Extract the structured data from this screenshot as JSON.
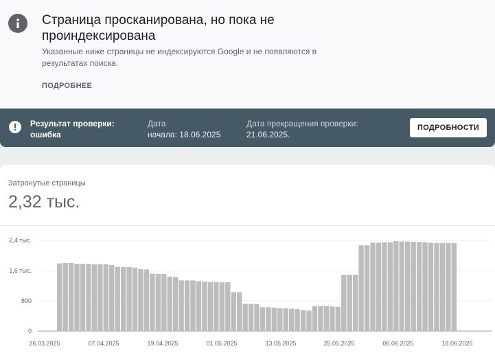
{
  "info": {
    "title": "Страница просканирована, но пока не проиндексирована",
    "description": "Указанные ниже страницы не индексируются Google и не появляются в результатах поиска.",
    "more_link": "ПОДРОБНЕЕ",
    "icon": "info-icon"
  },
  "status": {
    "icon": "warning-icon",
    "result_label": "Результат проверки: ошибка",
    "start_label": "Дата",
    "start_value": "начала: 18.06.2025",
    "end_label": "Дата прекращения проверки:",
    "end_value": "21.06.2025.",
    "details_button": "ПОДРОБНОСТИ"
  },
  "metric": {
    "label": "Затронутые страницы",
    "value": "2,32 тыс."
  },
  "colors": {
    "status_bar": "#455a64",
    "bar": "#bdbdbd"
  },
  "chart_data": {
    "type": "bar",
    "ylim": [
      0,
      2400
    ],
    "yticks": [
      {
        "value": 0,
        "label": "0"
      },
      {
        "value": 800,
        "label": "800"
      },
      {
        "value": 1600,
        "label": "1,6 тыс."
      },
      {
        "value": 2400,
        "label": "2,4 тыс."
      }
    ],
    "x_labels": [
      "26.03.2025",
      "07.04.2025",
      "19.04.2025",
      "01.05.2025",
      "13.05.2025",
      "25.05.2025",
      "06.06.2025",
      "18.06.2025"
    ],
    "values": [
      1790,
      1800,
      1800,
      1780,
      1780,
      1780,
      1770,
      1770,
      1770,
      1750,
      1700,
      1690,
      1690,
      1680,
      1640,
      1630,
      1520,
      1510,
      1510,
      1440,
      1430,
      1340,
      1340,
      1340,
      1320,
      1310,
      1300,
      1300,
      1290,
      1290,
      1030,
      1030,
      720,
      720,
      710,
      630,
      630,
      620,
      600,
      600,
      590,
      580,
      550,
      540,
      660,
      660,
      660,
      650,
      640,
      1490,
      1490,
      1490,
      2270,
      2270,
      2340,
      2340,
      2350,
      2350,
      2380,
      2370,
      2370,
      2360,
      2360,
      2350,
      2340,
      2330,
      2330,
      2330,
      2330
    ]
  }
}
